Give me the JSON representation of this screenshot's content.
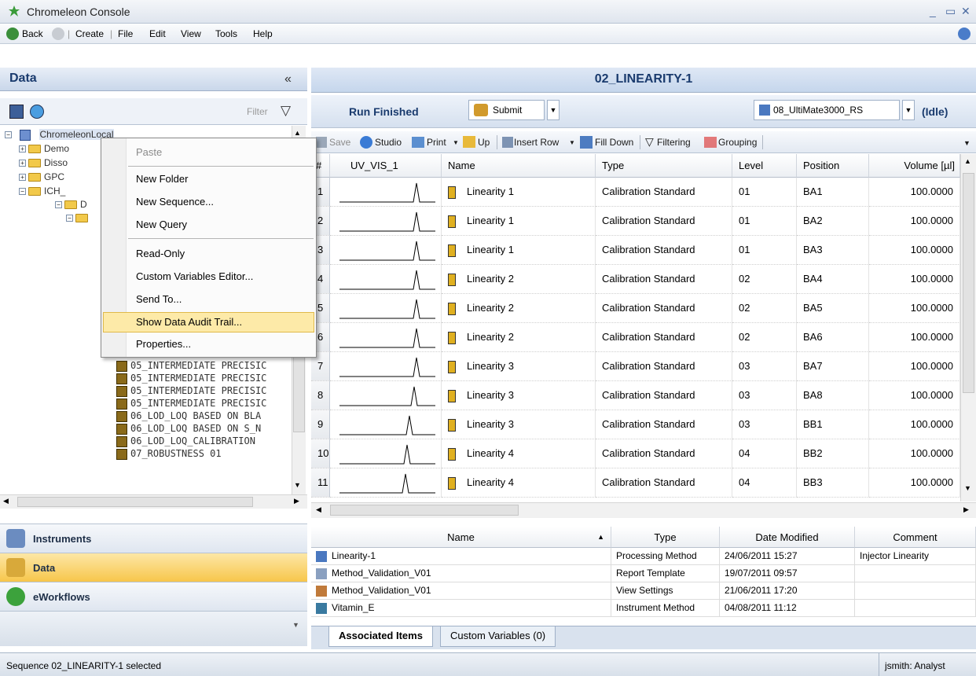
{
  "window": {
    "title": "Chromeleon Console"
  },
  "menu": {
    "back": "Back",
    "create": "Create",
    "file": "File",
    "edit": "Edit",
    "view": "View",
    "tools": "Tools",
    "help": "Help"
  },
  "left": {
    "title": "Data",
    "collapse": "«",
    "filter_placeholder": "Filter",
    "tree_root": "ChromeleonLocal",
    "tree_top": [
      "Demo",
      "Disso",
      "GPC",
      "ICH_"
    ],
    "tree_sub": [
      "D",
      ""
    ],
    "tree_seq": [
      "05_INTERMEDIATE PRECISIC",
      "05_INTERMEDIATE PRECISIC",
      "05_INTERMEDIATE PRECISIC",
      "05_INTERMEDIATE PRECISIC",
      "06_LOD_LOQ BASED ON BLA",
      "06_LOD_LOQ BASED ON S_N",
      "06_LOD_LOQ_CALIBRATION",
      "07_ROBUSTNESS 01"
    ]
  },
  "context_menu": {
    "items": [
      "Paste",
      "New Folder",
      "New Sequence...",
      "New Query",
      "Read-Only",
      "Custom Variables Editor...",
      "Send To...",
      "Show Data Audit Trail...",
      "Properties..."
    ]
  },
  "nav": {
    "instruments": "Instruments",
    "data": "Data",
    "eworkflows": "eWorkflows"
  },
  "right": {
    "title": "02_LINEARITY-1",
    "run_status": "Run Finished",
    "submit": "Submit",
    "instrument": "08_UltiMate3000_RS",
    "idle": "(Idle)"
  },
  "toolbar": {
    "save": "Save",
    "studio": "Studio",
    "print": "Print",
    "up": "Up",
    "insert_row": "Insert Row",
    "fill_down": "Fill Down",
    "filtering": "Filtering",
    "grouping": "Grouping"
  },
  "grid": {
    "headers": [
      "#",
      "UV_VIS_1",
      "Name",
      "Type",
      "Level",
      "Position",
      "Volume [µl]"
    ],
    "rows": [
      {
        "n": "1",
        "name": "Linearity 1",
        "type": "Calibration Standard",
        "level": "01",
        "pos": "BA1",
        "vol": "100.0000"
      },
      {
        "n": "2",
        "name": "Linearity 1",
        "type": "Calibration Standard",
        "level": "01",
        "pos": "BA2",
        "vol": "100.0000"
      },
      {
        "n": "3",
        "name": "Linearity 1",
        "type": "Calibration Standard",
        "level": "01",
        "pos": "BA3",
        "vol": "100.0000"
      },
      {
        "n": "4",
        "name": "Linearity 2",
        "type": "Calibration Standard",
        "level": "02",
        "pos": "BA4",
        "vol": "100.0000"
      },
      {
        "n": "5",
        "name": "Linearity 2",
        "type": "Calibration Standard",
        "level": "02",
        "pos": "BA5",
        "vol": "100.0000"
      },
      {
        "n": "6",
        "name": "Linearity 2",
        "type": "Calibration Standard",
        "level": "02",
        "pos": "BA6",
        "vol": "100.0000"
      },
      {
        "n": "7",
        "name": "Linearity 3",
        "type": "Calibration Standard",
        "level": "03",
        "pos": "BA7",
        "vol": "100.0000"
      },
      {
        "n": "8",
        "name": "Linearity 3",
        "type": "Calibration Standard",
        "level": "03",
        "pos": "BA8",
        "vol": "100.0000"
      },
      {
        "n": "9",
        "name": "Linearity 3",
        "type": "Calibration Standard",
        "level": "03",
        "pos": "BB1",
        "vol": "100.0000"
      },
      {
        "n": "10",
        "name": "Linearity 4",
        "type": "Calibration Standard",
        "level": "04",
        "pos": "BB2",
        "vol": "100.0000"
      },
      {
        "n": "11",
        "name": "Linearity 4",
        "type": "Calibration Standard",
        "level": "04",
        "pos": "BB3",
        "vol": "100.0000"
      }
    ]
  },
  "assoc": {
    "headers": [
      "Name",
      "Type",
      "Date Modified",
      "Comment"
    ],
    "rows": [
      {
        "name": "Linearity-1",
        "type": "Processing Method",
        "date": "24/06/2011 15:27",
        "comment": "Injector Linearity"
      },
      {
        "name": "Method_Validation_V01",
        "type": "Report Template",
        "date": "19/07/2011 09:57",
        "comment": ""
      },
      {
        "name": "Method_Validation_V01",
        "type": "View Settings",
        "date": "21/06/2011 17:20",
        "comment": ""
      },
      {
        "name": "Vitamin_E",
        "type": "Instrument Method",
        "date": "04/08/2011 11:12",
        "comment": ""
      }
    ]
  },
  "tabs": {
    "associated": "Associated Items",
    "custom": "Custom Variables (0)"
  },
  "status": {
    "left": "Sequence 02_LINEARITY-1 selected",
    "right": "jsmith: Analyst"
  },
  "colors": {
    "accent": "#1a3b6e",
    "selected_nav": "#f7c64b",
    "highlight": "#fdeaa8"
  }
}
